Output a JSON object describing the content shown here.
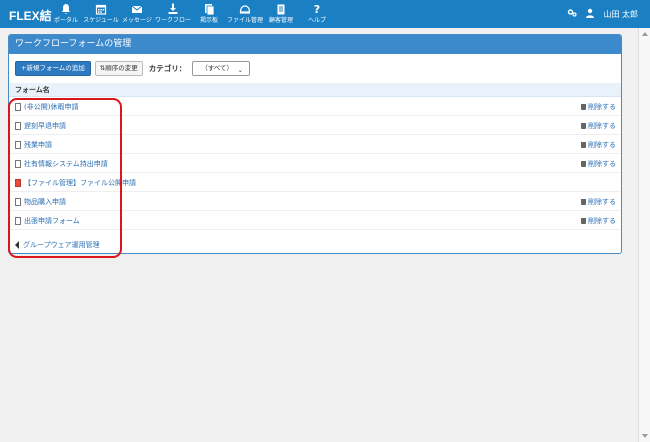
{
  "app": {
    "logo": "FLEX結",
    "user_name": "山田 太郎"
  },
  "nav": [
    {
      "label": "ポータル",
      "icon": "bell-icon"
    },
    {
      "label": "スケジュール",
      "icon": "calendar-icon"
    },
    {
      "label": "メッセージ",
      "icon": "envelope-icon"
    },
    {
      "label": "ワークフロー",
      "icon": "workflow-icon"
    },
    {
      "label": "掲示板",
      "icon": "board-icon"
    },
    {
      "label": "ファイル管理",
      "icon": "folder-icon"
    },
    {
      "label": "顧客管理",
      "icon": "clipboard-icon"
    },
    {
      "label": "ヘルプ",
      "icon": "help-icon"
    }
  ],
  "panel": {
    "title": "ワークフローフォームの管理",
    "add_form_button": "+新規フォームの追加",
    "sort_button": "順序の変更",
    "category_label": "カテゴリ：",
    "category_value": "（すべて）",
    "column_header": "フォーム名",
    "delete_label": "削除する",
    "back_link": "グループウェア運用管理"
  },
  "forms": [
    {
      "name": "(非公開)休暇申請",
      "deletable": true,
      "icon": "document-icon"
    },
    {
      "name": "遅刻早退申請",
      "deletable": true,
      "icon": "document-icon"
    },
    {
      "name": "残業申請",
      "deletable": true,
      "icon": "document-icon"
    },
    {
      "name": "社有情報システム持出申請",
      "deletable": true,
      "icon": "document-icon"
    },
    {
      "name": "【ファイル管理】ファイル公開申請",
      "deletable": false,
      "icon": "document-red-icon"
    },
    {
      "name": "物品購入申請",
      "deletable": true,
      "icon": "document-icon"
    },
    {
      "name": "出張申請フォーム",
      "deletable": true,
      "icon": "document-icon"
    }
  ],
  "colors": {
    "header_blue": "#1b7fc4",
    "panel_header_blue": "#3c89cc",
    "link_blue": "#2a6fb4",
    "highlight_red": "#d9161b"
  }
}
